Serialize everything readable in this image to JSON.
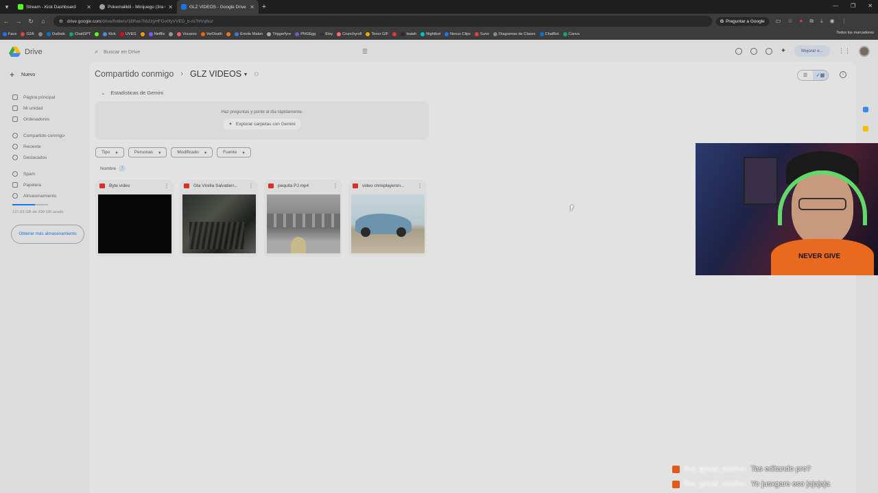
{
  "browser": {
    "tabs": [
      {
        "title": "Stream - Kick Dashboard",
        "color": "#53fc18",
        "active": false
      },
      {
        "title": "Pokemalikili - Minijuego (3ra G",
        "color": "#9aa0a6",
        "active": false
      },
      {
        "title": "GLZ VIDEOS - Google Drive",
        "color": "#1a73e8",
        "active": true
      }
    ],
    "url": "drive.google.com",
    "url_path": "/drive/folders/18Rxe7hb2zyHFGv0fyVVED_b-m7HVq6oz",
    "ask_google": "Preguntar a Google",
    "bookmarks": [
      "Face",
      "G2A",
      "",
      "Outlook",
      "ChatGPT",
      "",
      "Kick",
      "UVEG",
      "",
      "Netflix",
      "",
      "Vocaroo",
      "VerDeath",
      "",
      "Emote Maker",
      "Triggerfyre",
      "PNGEgg",
      "Etsy",
      "Crunchyroll",
      "Tenor GIF",
      "",
      "Isaiah",
      "Nightbot",
      "Nexus Clips",
      "Suno",
      "Diagramas de Clases",
      "ChatBot",
      "Canva"
    ],
    "all_bookmarks": "Todos los marcadores"
  },
  "drive": {
    "logo_text": "Drive",
    "search_placeholder": "Buscar en Drive",
    "upgrade": "Mejorar e...",
    "new_label": "Nuevo",
    "sidebar": [
      {
        "label": "Página principal"
      },
      {
        "label": "Mi unidad"
      },
      {
        "label": "Ordenadores"
      },
      {
        "label": "Compartido conmigo"
      },
      {
        "label": "Reciente"
      },
      {
        "label": "Destacados"
      },
      {
        "label": "Spam"
      },
      {
        "label": "Papelera"
      },
      {
        "label": "Almacenamiento"
      }
    ],
    "storage_used_fraction": 0.64,
    "storage_text": "127,63 GB de 200 GB usado",
    "storage_button": "Obtener más almacenamiento",
    "breadcrumb": {
      "parent": "Compartido conmigo",
      "current": "GLZ VIDEOS"
    },
    "gemini": {
      "header": "Estadísticas de Gemini",
      "prompt": "Haz preguntas y ponte al día rápidamente.",
      "explore": "Explorar carpetas con Gemini"
    },
    "filters": [
      "Tipo",
      "Personas",
      "Modificado",
      "Fuente"
    ],
    "sort_label": "Nombre",
    "files": [
      {
        "name": "Byte video",
        "thumb": "black"
      },
      {
        "name": "Gta Virella Salvatierr...",
        "thumb": "gta"
      },
      {
        "name": "pequita PJ.mp4",
        "thumb": "pj"
      },
      {
        "name": "video chrisplayeron...",
        "thumb": "car"
      }
    ]
  },
  "chat": [
    {
      "user": "the_great_nacho:",
      "message": "Tas editando pro?"
    },
    {
      "user": "the_great_nacho:",
      "message": "Yo jusxgare eso jajajaja"
    }
  ],
  "webcam": {
    "shirt_text": "NEVER GIVE"
  }
}
